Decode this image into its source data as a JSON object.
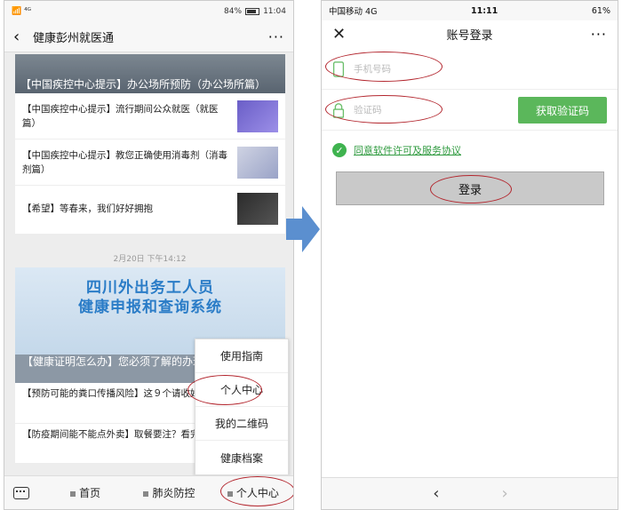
{
  "left_phone": {
    "status": {
      "left": "📶 ⁴ᴳ",
      "right": "84%",
      "time": "11:04"
    },
    "nav": {
      "back_icon": "‹",
      "title": "健康彭州就医通",
      "more": "···"
    },
    "card1": {
      "headline": "【中国疾控中心提示】办公场所预防（办公场所篇）",
      "articles": [
        {
          "text": "【中国疾控中心提示】流行期间公众就医（就医篇）"
        },
        {
          "text": "【中国疾控中心提示】教您正确使用消毒剂（消毒剂篇）"
        },
        {
          "text": "【希望】等春来，我们好好拥抱"
        }
      ]
    },
    "timestamp": "2月20日 下午14:12",
    "card2": {
      "banner_line1": "四川外出务工人员",
      "banner_line2": "健康申报和查询系统",
      "caption": "【健康证明怎么办】您必须了解的办理方式在这里！",
      "articles": [
        {
          "text": "【预防可能的粪口传播风险】这９个请收好！"
        },
        {
          "text": "【防疫期间能不能点外卖】取餐要注？看完让你放心吃饭"
        }
      ]
    },
    "popup": [
      "使用指南",
      "个人中心",
      "我的二维码",
      "健康档案"
    ],
    "bottom_tabs": [
      "首页",
      "肺炎防控",
      "个人中心"
    ]
  },
  "right_phone": {
    "status": {
      "carrier": "中国移动  4G",
      "time": "11:11",
      "battery": "61%"
    },
    "nav": {
      "close_icon": "✕",
      "title": "账号登录",
      "more": "···"
    },
    "phone_placeholder": "手机号码",
    "code_placeholder": "验证码",
    "get_code_label": "获取验证码",
    "agreement": "同意软件许可及服务协议",
    "login_label": "登录",
    "back_nav": "‹",
    "forward_nav": "›"
  },
  "colors": {
    "accent_green": "#5bb75b",
    "annotation_red": "#b3262e",
    "arrow_blue": "#5b8fcf"
  }
}
